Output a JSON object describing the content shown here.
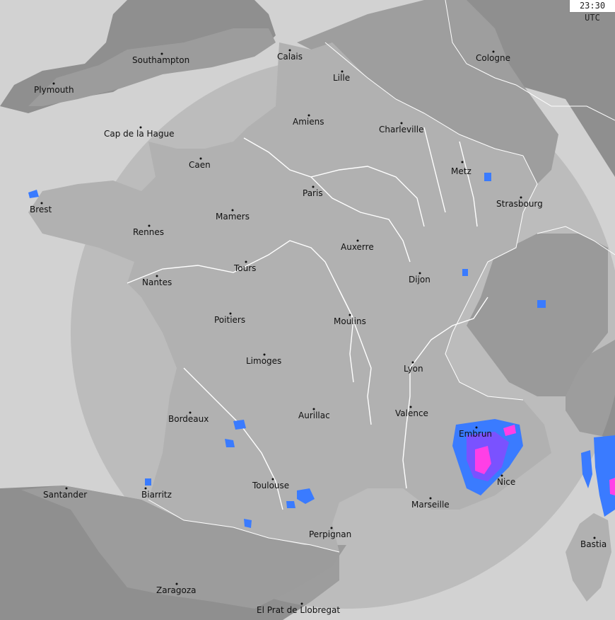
{
  "timestamp": "23:30 UTC",
  "colors": {
    "sea": "#d2d2d2",
    "coverage": "#a9a9a9",
    "land_outside": "#8f8f8f",
    "france": "#b1b1b1",
    "rivers": "#ffffff",
    "rain_light": "#3a7bff",
    "rain_moderate": "#7a52ff",
    "rain_heavy": "#ff3fe6"
  },
  "cities": [
    {
      "name": "Southampton"
    },
    {
      "name": "Plymouth"
    },
    {
      "name": "Calais"
    },
    {
      "name": "Lille"
    },
    {
      "name": "Cologne"
    },
    {
      "name": "Cap de la Hague"
    },
    {
      "name": "Amiens"
    },
    {
      "name": "Charleville"
    },
    {
      "name": "Caen"
    },
    {
      "name": "Metz"
    },
    {
      "name": "Paris"
    },
    {
      "name": "Strasbourg"
    },
    {
      "name": "Brest"
    },
    {
      "name": "Mamers"
    },
    {
      "name": "Rennes"
    },
    {
      "name": "Auxerre"
    },
    {
      "name": "Tours"
    },
    {
      "name": "Dijon"
    },
    {
      "name": "Nantes"
    },
    {
      "name": "Poitiers"
    },
    {
      "name": "Moulins"
    },
    {
      "name": "Limoges"
    },
    {
      "name": "Lyon"
    },
    {
      "name": "Valence"
    },
    {
      "name": "Aurillac"
    },
    {
      "name": "Bordeaux"
    },
    {
      "name": "Embrun"
    },
    {
      "name": "Nice"
    },
    {
      "name": "Toulouse"
    },
    {
      "name": "Santander"
    },
    {
      "name": "Biarritz"
    },
    {
      "name": "Marseille"
    },
    {
      "name": "Perpignan"
    },
    {
      "name": "Bastia"
    },
    {
      "name": "Zaragoza"
    },
    {
      "name": "El Prat de Llobregat"
    }
  ]
}
